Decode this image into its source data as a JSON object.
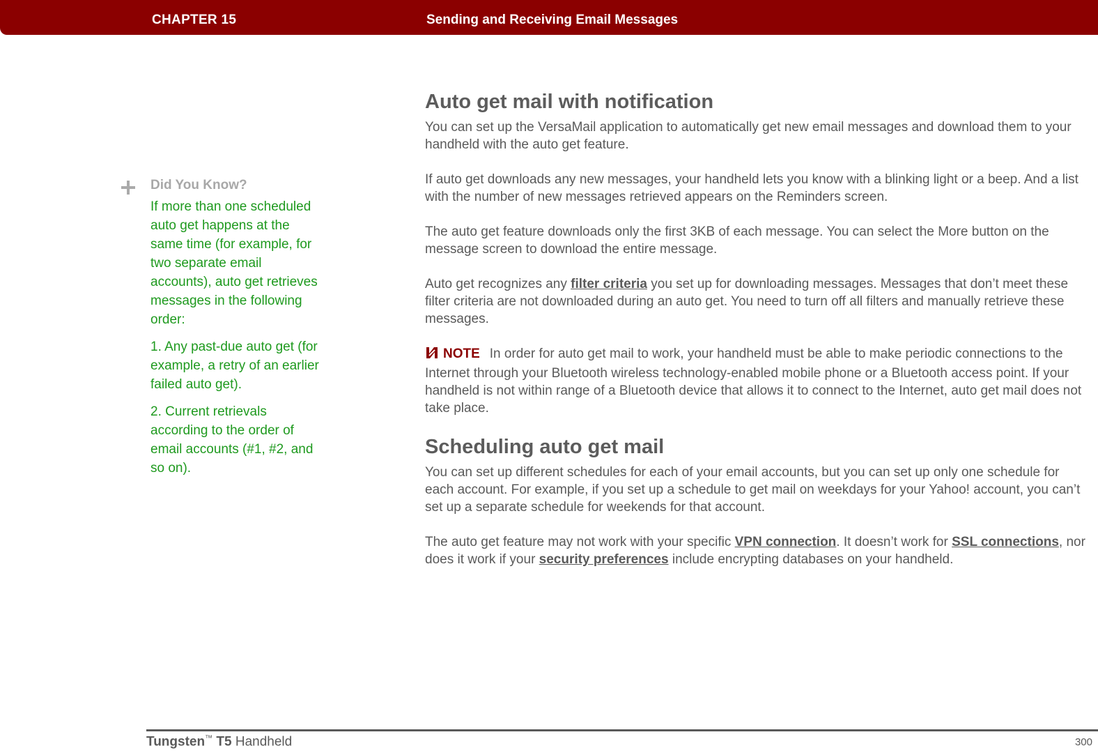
{
  "header": {
    "chapter": "CHAPTER 15",
    "title": "Sending and Receiving Email Messages"
  },
  "sidebar": {
    "icon": "plus-icon",
    "title": "Did You Know?",
    "paragraphs": [
      "If more than one scheduled auto get happens at the same time (for example, for two separate email accounts), auto get retrieves messages in the following order:",
      "1. Any past-due auto get (for example, a retry of an earlier failed auto get).",
      "2. Current retrievals according to the order of email accounts (#1, #2, and so on)."
    ]
  },
  "sections": [
    {
      "heading": "Auto get mail with notification",
      "p1": "You can set up the VersaMail application to automatically get new email messages and download them to your handheld with the auto get feature.",
      "p2": "If auto get downloads any new messages, your handheld lets you know with a blinking light or a beep. And a list with the number of new messages retrieved appears on the Reminders screen.",
      "p3": "The auto get feature downloads only the first 3KB of each message. You can select the More button on the message screen to download the entire message.",
      "p4_before": "Auto get recognizes any ",
      "p4_link": "filter criteria",
      "p4_after": " you set up for downloading messages. Messages that don’t meet these filter criteria are not downloaded during an auto get. You need to turn off all filters and manually retrieve these messages.",
      "note_icon": "note-icon",
      "note_label": "NOTE",
      "note_text": "In order for auto get mail to work, your handheld must be able to make periodic connections to the Internet through your Bluetooth wireless technology-enabled mobile phone or a Bluetooth access point. If your handheld is not within range of a Bluetooth device that allows it to connect to the Internet, auto get mail does not take place."
    },
    {
      "heading": "Scheduling auto get mail",
      "p1": "You can set up different schedules for each of your email accounts, but you can set up only one schedule for each account. For example, if you set up a schedule to get mail on weekdays for your Yahoo! account, you can’t set up a separate schedule for weekends for that account.",
      "p2_a": "The auto get feature may not work with your specific ",
      "p2_link1": "VPN connection",
      "p2_b": ". It doesn’t work for ",
      "p2_link2": "SSL connections",
      "p2_c": ", nor does it work if your ",
      "p2_link3": "security preferences",
      "p2_d": " include encrypting databases on your handheld."
    }
  ],
  "footer": {
    "product_bold": "Tungsten",
    "trademark": "™",
    "model": "T5",
    "product_rest": "Handheld",
    "page_number": "300"
  },
  "colors": {
    "header_bg": "#8b0000",
    "tip_text": "#1f9a1f",
    "body_text": "#5a5a5a"
  }
}
